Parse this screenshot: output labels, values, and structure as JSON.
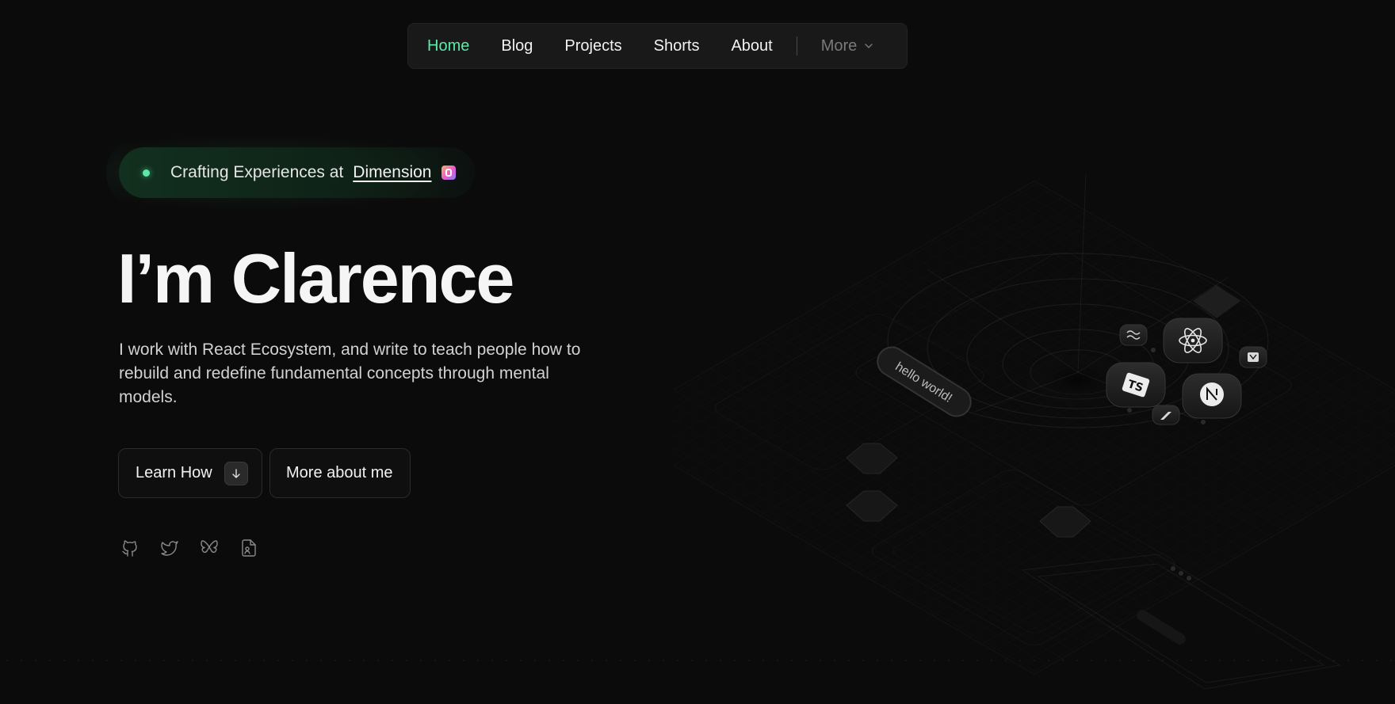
{
  "nav": {
    "items": [
      {
        "label": "Home",
        "active": true
      },
      {
        "label": "Blog"
      },
      {
        "label": "Projects"
      },
      {
        "label": "Shorts"
      },
      {
        "label": "About"
      }
    ],
    "more_label": "More"
  },
  "badge": {
    "text": "Crafting Experiences at",
    "link": "Dimension"
  },
  "hero": {
    "title": "I’m Clarence",
    "description": "I work with React Ecosystem, and write to teach people how to rebuild and redefine fundamental concepts through mental models."
  },
  "buttons": {
    "learn_how": "Learn How",
    "more_about": "More about me"
  },
  "socials": [
    "github-icon",
    "twitter-icon",
    "bluesky-icon",
    "resume-icon"
  ],
  "illustration": {
    "pill_text": "hello world!",
    "chips": [
      "react-icon",
      "typescript-icon",
      "nextjs-icon",
      "tailwind-icon",
      "vercel-icon",
      "framer-icon"
    ]
  },
  "colors": {
    "accent": "#5ee8a9",
    "background": "#0b0b0b",
    "nav_bg": "#191919"
  }
}
